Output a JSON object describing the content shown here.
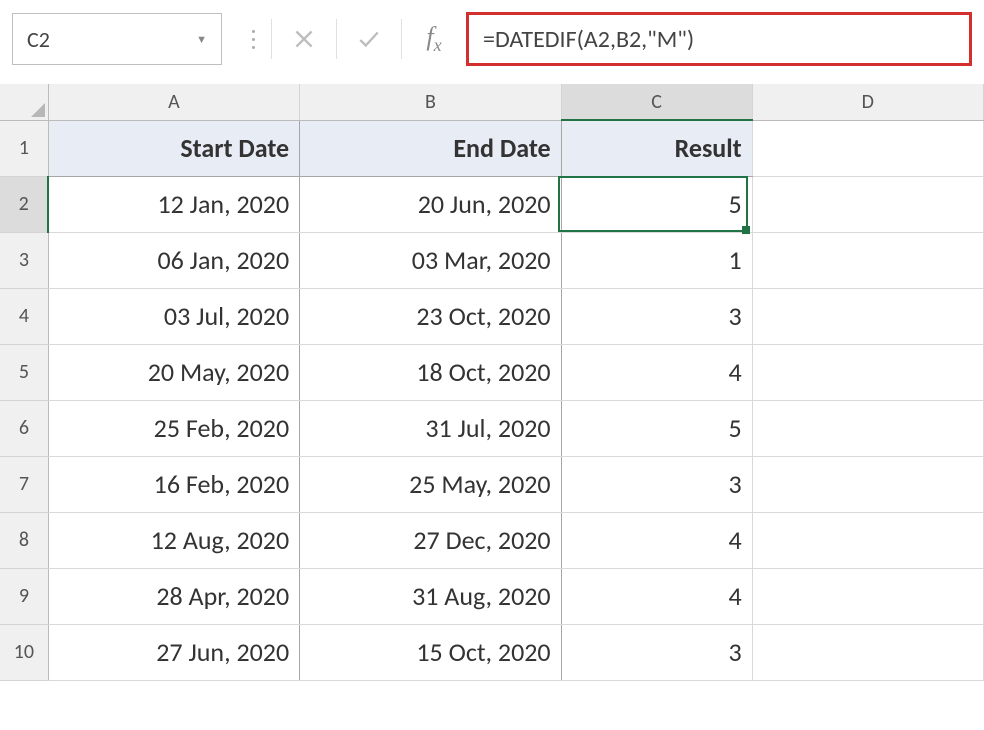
{
  "nameBox": {
    "value": "C2"
  },
  "formulaBar": {
    "formula": "=DATEDIF(A2,B2,\"M\")"
  },
  "columns": [
    "A",
    "B",
    "C",
    "D"
  ],
  "rowNumbers": [
    1,
    2,
    3,
    4,
    5,
    6,
    7,
    8,
    9,
    10
  ],
  "headerRow": {
    "A": "Start Date",
    "B": "End Date",
    "C": "Result"
  },
  "rows": [
    {
      "A": "12 Jan, 2020",
      "B": "20 Jun, 2020",
      "C": "5"
    },
    {
      "A": "06 Jan, 2020",
      "B": "03 Mar, 2020",
      "C": "1"
    },
    {
      "A": "03 Jul, 2020",
      "B": "23 Oct, 2020",
      "C": "3"
    },
    {
      "A": "20 May, 2020",
      "B": "18 Oct, 2020",
      "C": "4"
    },
    {
      "A": "25 Feb, 2020",
      "B": "31 Jul, 2020",
      "C": "5"
    },
    {
      "A": "16 Feb, 2020",
      "B": "25 May, 2020",
      "C": "3"
    },
    {
      "A": "12 Aug, 2020",
      "B": "27 Dec, 2020",
      "C": "4"
    },
    {
      "A": "28 Apr, 2020",
      "B": "31 Aug, 2020",
      "C": "4"
    },
    {
      "A": "27 Jun, 2020",
      "B": "15 Oct, 2020",
      "C": "3"
    }
  ],
  "selection": {
    "cell": "C2",
    "activeRow": 2,
    "activeCol": "C"
  }
}
